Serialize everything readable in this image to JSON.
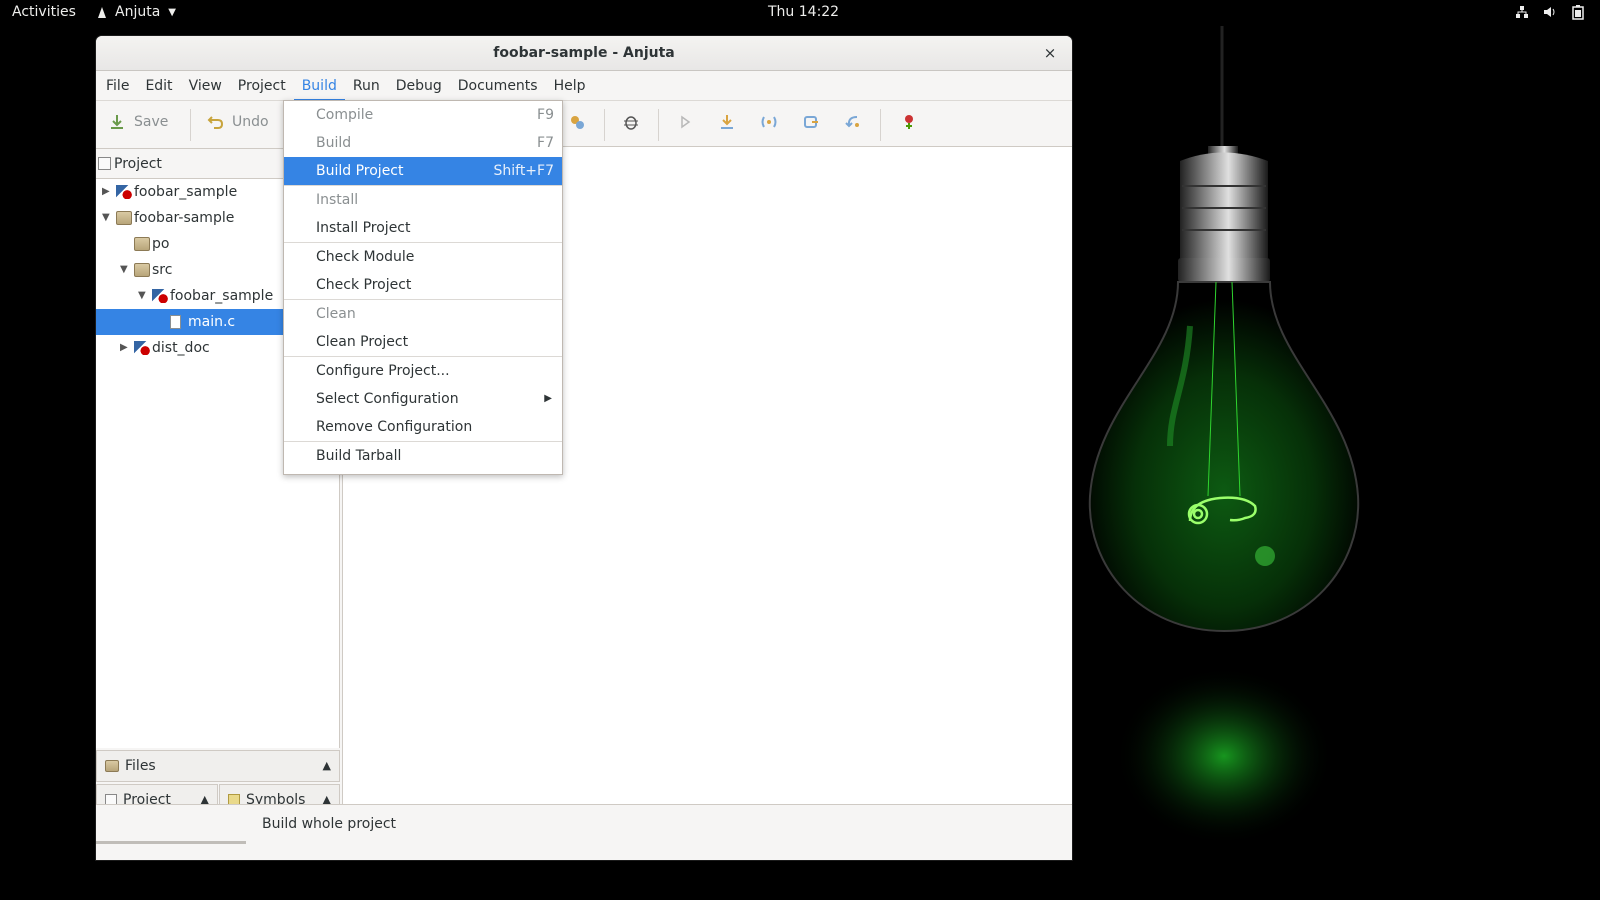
{
  "topbar": {
    "activities": "Activities",
    "app_name": "Anjuta",
    "clock": "Thu 14:22",
    "tray_icons": [
      "network-icon",
      "volume-icon",
      "battery-icon"
    ]
  },
  "window": {
    "title": "foobar-sample - Anjuta",
    "close_glyph": "×"
  },
  "menubar": [
    "File",
    "Edit",
    "View",
    "Project",
    "Build",
    "Run",
    "Debug",
    "Documents",
    "Help"
  ],
  "menubar_active": "Build",
  "toolbar": {
    "save_label": "Save",
    "undo_label": "Undo"
  },
  "project_panel": {
    "header": "Project",
    "tree": [
      {
        "label": "foobar_sample",
        "icon": "module-icon",
        "expander": "▶"
      },
      {
        "label": "foobar-sample",
        "icon": "folder-icon",
        "expander": "▼"
      },
      {
        "label": "po",
        "icon": "folder-icon",
        "expander": ""
      },
      {
        "label": "src",
        "icon": "folder-icon",
        "expander": "▼"
      },
      {
        "label": "foobar_sample",
        "icon": "module-icon",
        "expander": "▼"
      },
      {
        "label": "main.c",
        "icon": "file-icon",
        "expander": "",
        "selected": true
      },
      {
        "label": "dist_doc",
        "icon": "module-icon",
        "expander": "▶"
      }
    ]
  },
  "bottom_tabs": {
    "files": "Files",
    "project": "Project",
    "symbols": "Symbols"
  },
  "statusbar": {
    "message": "Build whole project"
  },
  "build_menu": {
    "items": [
      {
        "label": "Compile",
        "accel": "F9",
        "disabled": true
      },
      {
        "label": "Build",
        "accel": "F7",
        "disabled": true
      },
      {
        "label": "Build Project",
        "accel": "Shift+F7",
        "highlighted": true
      },
      {
        "label": "Install",
        "accel": "",
        "disabled": true
      },
      {
        "label": "Install Project",
        "accel": ""
      },
      {
        "label": "Check Module",
        "accel": ""
      },
      {
        "label": "Check Project",
        "accel": ""
      },
      {
        "label": "Clean",
        "accel": "",
        "disabled": true
      },
      {
        "label": "Clean Project",
        "accel": ""
      },
      {
        "label": "Configure Project...",
        "accel": ""
      },
      {
        "label": "Select Configuration",
        "accel": "",
        "submenu": true
      },
      {
        "label": "Remove Configuration",
        "accel": ""
      },
      {
        "label": "Build Tarball",
        "accel": ""
      }
    ]
  },
  "colors": {
    "accent": "#3584e4",
    "bulb_glow": "#2fd42f"
  }
}
